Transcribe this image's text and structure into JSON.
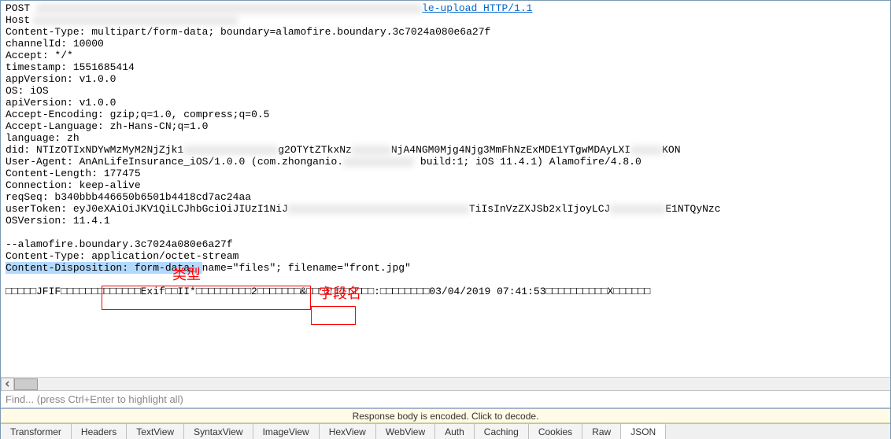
{
  "request": {
    "method": "POST",
    "url_suffix": "le-upload HTTP/1.1",
    "headers": [
      {
        "name": "Host",
        "value": ""
      },
      {
        "name": "Content-Type",
        "value": "multipart/form-data; boundary=alamofire.boundary.3c7024a080e6a27f"
      },
      {
        "name": "channelId",
        "value": "10000"
      },
      {
        "name": "Accept",
        "value": "*/*"
      },
      {
        "name": "timestamp",
        "value": "1551685414"
      },
      {
        "name": "appVersion",
        "value": "v1.0.0"
      },
      {
        "name": "OS",
        "value": "iOS"
      },
      {
        "name": "apiVersion",
        "value": "v1.0.0"
      },
      {
        "name": "Accept-Encoding",
        "value": "gzip;q=1.0, compress;q=0.5"
      },
      {
        "name": "Accept-Language",
        "value": "zh-Hans-CN;q=1.0"
      },
      {
        "name": "language",
        "value": "zh"
      },
      {
        "name": "did",
        "value_prefix": "NTIzOTIxNDYwMzMyM2NjZjk1",
        "value_mid": "g2OTYtZTkxNz",
        "value_suffix": "NjA4NGM0Mjg4Njg3MmFhNzExMDE1YTgwMDAyLXI",
        "value_end": "KON"
      },
      {
        "name": "User-Agent",
        "value_prefix": "AnAnLifeInsurance_iOS/1.0.0 (com.zhonganio.",
        "value_suffix": " build:1; iOS 11.4.1) Alamofire/4.8.0"
      },
      {
        "name": "Content-Length",
        "value": "177475"
      },
      {
        "name": "Connection",
        "value": "keep-alive"
      },
      {
        "name": "reqSeq",
        "value": "b340bbb446650b6501b4418cd7ac24aa"
      },
      {
        "name": "userToken",
        "value_prefix": "eyJ0eXAiOiJKV1QiLCJhbGciOiJIUzI1NiJ",
        "value_mid": "TiIsInVzZXJSb2xlIjoyLCJ",
        "value_end": "E1NTQyNzc"
      },
      {
        "name": "OSVersion",
        "value": "11.4.1"
      }
    ],
    "boundary_line": "--alamofire.boundary.3c7024a080e6a27f",
    "part_content_type": "Content-Type: application/octet-stream",
    "content_disposition_prefix": "Content-Disposition: form-data; ",
    "content_disposition_name": "name=\"files\"",
    "content_disposition_suffix": "; filename=\"front.jpg\"",
    "binary_preview": "□□□□□JFIF□□□□□□□□□□□□□Exif□□II*□□□□□□□□□2□□□□□□□&□□□i□□□□□□□:□□□□□□□□03/04/2019 07:41:53□□□□□□□□□□X□□□□□□"
  },
  "annotations": {
    "type_label": "类型",
    "field_label": "字段名"
  },
  "find_bar": {
    "placeholder": "Find... (press Ctrl+Enter to highlight all)"
  },
  "decode_bar": {
    "text": "Response body is encoded. Click to decode."
  },
  "tabs": [
    {
      "label": "Transformer",
      "active": false
    },
    {
      "label": "Headers",
      "active": false
    },
    {
      "label": "TextView",
      "active": false
    },
    {
      "label": "SyntaxView",
      "active": false
    },
    {
      "label": "ImageView",
      "active": false
    },
    {
      "label": "HexView",
      "active": false
    },
    {
      "label": "WebView",
      "active": false
    },
    {
      "label": "Auth",
      "active": false
    },
    {
      "label": "Caching",
      "active": false
    },
    {
      "label": "Cookies",
      "active": false
    },
    {
      "label": "Raw",
      "active": false
    },
    {
      "label": "JSON",
      "active": true
    }
  ]
}
